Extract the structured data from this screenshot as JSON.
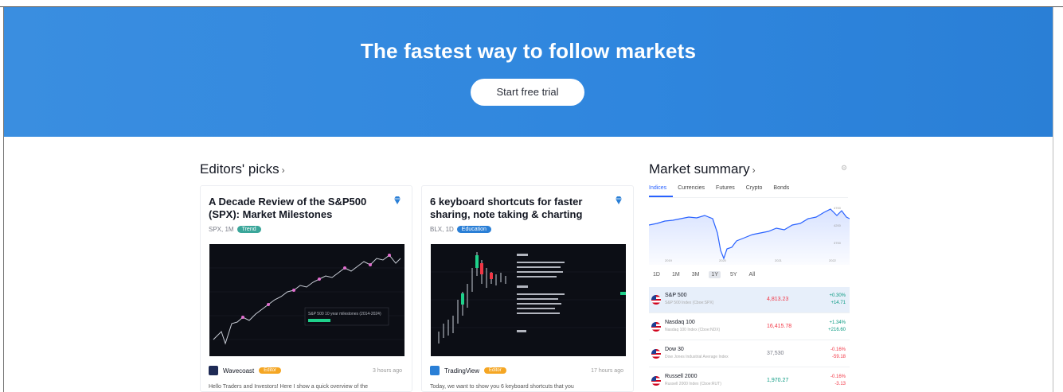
{
  "hero": {
    "title": "The fastest way to follow markets",
    "cta_label": "Start free trial"
  },
  "editors_picks": {
    "title": "Editors' picks",
    "chevron": "›",
    "cards": [
      {
        "title": "A Decade Review of the S&P500 (SPX): Market Milestones",
        "symbol": "SPX, 1M",
        "tag": "Trend",
        "author": "Wavecoast",
        "badge": "Editor",
        "time": "3 hours ago",
        "snippet": "Hello Traders and Investors! Here I show a quick overview of the",
        "chart_caption": "S&P 500 10 year milestones (2014-2024)"
      },
      {
        "title": "6 keyboard shortcuts for faster sharing, note taking & charting",
        "symbol": "BLX, 1D",
        "tag": "Education",
        "author": "TradingView",
        "badge": "Editor",
        "time": "17 hours ago",
        "snippet": "Today, we want to show you 6 keyboard shortcuts that you"
      }
    ]
  },
  "market_summary": {
    "title": "Market summary",
    "chevron": "›",
    "tabs": [
      "Indices",
      "Currencies",
      "Futures",
      "Crypto",
      "Bonds"
    ],
    "active_tab": 0,
    "x_labels": [
      "2019",
      "2020",
      "2021",
      "2022"
    ],
    "y_labels": [
      "4700",
      "4200",
      "3700"
    ],
    "ranges": [
      "1D",
      "1M",
      "3M",
      "1Y",
      "5Y",
      "All"
    ],
    "active_range": 3,
    "rows": [
      {
        "name": "S&P 500",
        "desc": "S&P 500 Index (Cboe:SPX)",
        "price": "4,813.23",
        "change": "+0.30%",
        "abs": "+14.71",
        "dir": "down"
      },
      {
        "name": "Nasdaq 100",
        "desc": "Nasdaq 100 Index (Cboe:NDX)",
        "price": "16,415.78",
        "change": "+1.34%",
        "abs": "+216.60",
        "dir": "down"
      },
      {
        "name": "Dow 30",
        "desc": "Dow Jones Industrial Average Index",
        "price": "37,530",
        "change": "-0.16%",
        "abs": "-59.18",
        "dir": "neutral"
      },
      {
        "name": "Russell 2000",
        "desc": "Russell 2000 Index (Cboe:RUT)",
        "price": "1,970.27",
        "change": "-0.16%",
        "abs": "-3.13",
        "dir": "up"
      }
    ]
  },
  "colors": {
    "hero_blue": "#2f86de",
    "accent": "#2962ff",
    "up": "#089981",
    "down": "#f23645"
  }
}
